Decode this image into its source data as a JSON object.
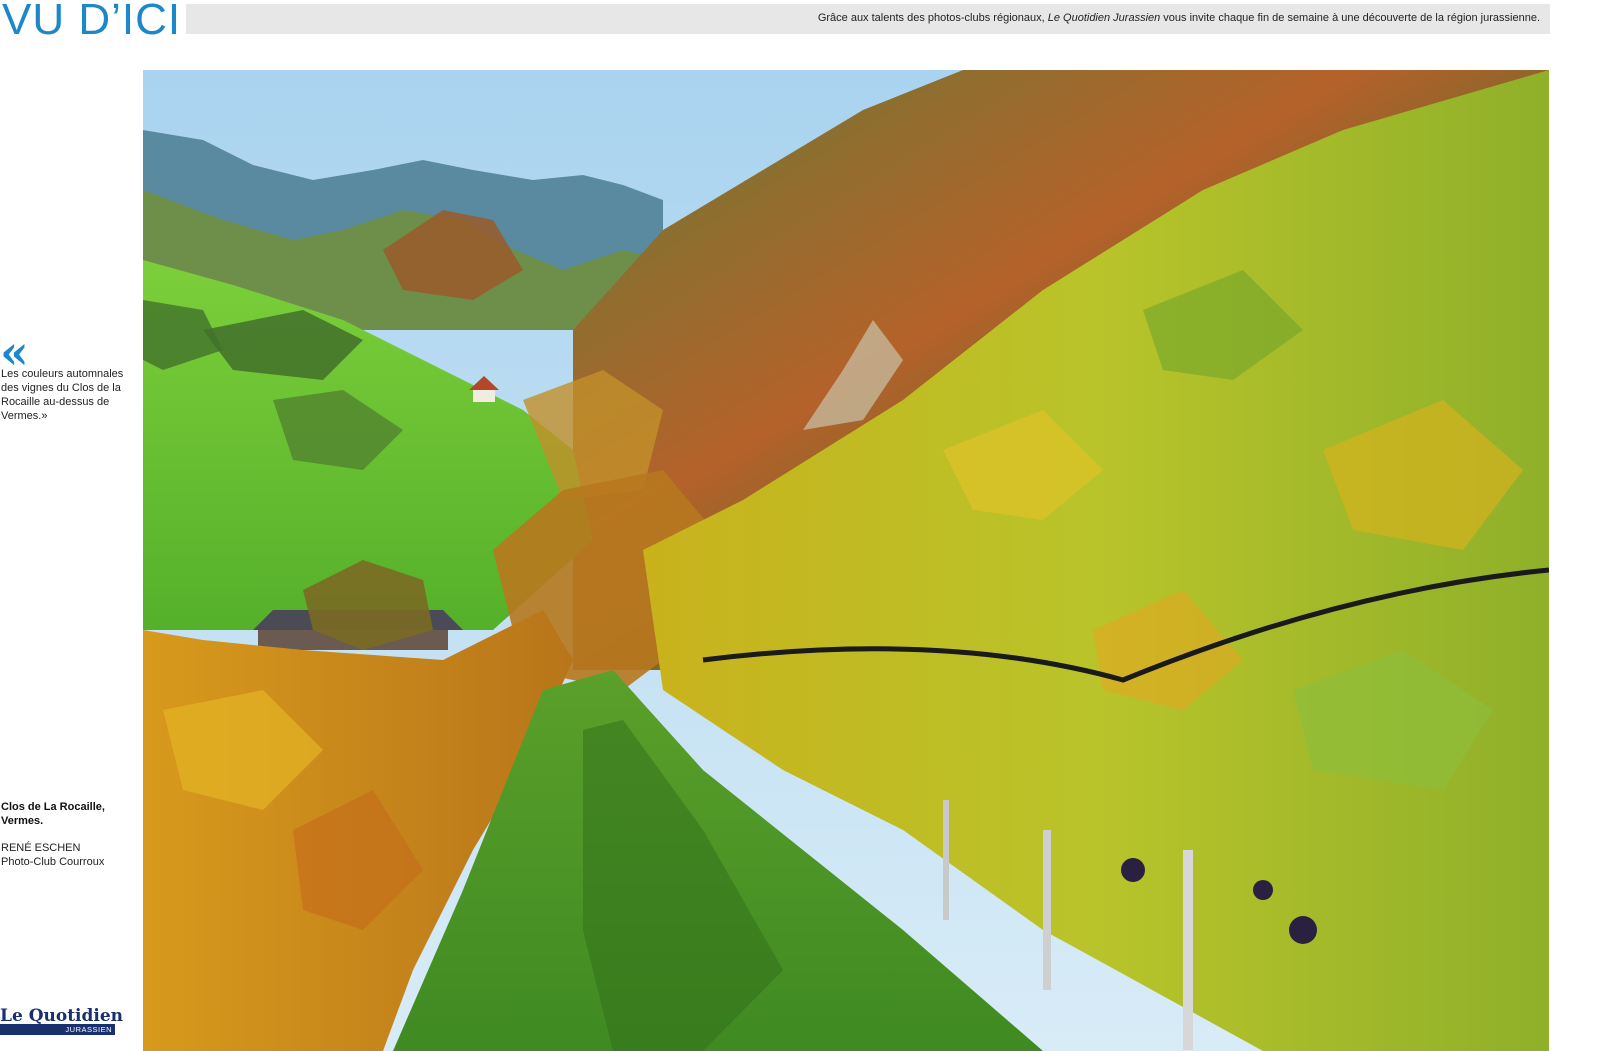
{
  "header": {
    "section_title": "VU D’ICI",
    "intro_before": "Grâce aux talents des photos-clubs régionaux, ",
    "intro_publication": "Le Quotidien Jurassien",
    "intro_after": " vous invite chaque fin de semaine à une découverte de la région jurassienne.",
    "accent_color": "#1c87c9"
  },
  "quote": {
    "mark": "«",
    "text": "Les couleurs automnales des vignes du Clos de la Rocaille au-dessus de Vermes.»"
  },
  "caption": {
    "title": "Clos de La Rocaille, Vermes.",
    "photographer": "RENÉ ESCHEN",
    "club": "Photo-Club Courroux"
  },
  "logo": {
    "name": "Le Quotidien",
    "sub": "JURASSIEN",
    "color": "#1a2f6e"
  },
  "photo": {
    "subject": "vineyard-autumn-landscape"
  }
}
